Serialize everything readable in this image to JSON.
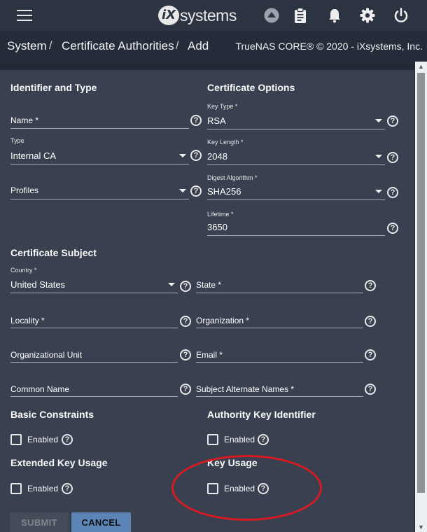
{
  "topbar": {
    "logo_mark": "iX",
    "logo_text": "systems",
    "icons": [
      "menu-icon",
      "truecommand-icon",
      "clipboard-icon",
      "bell-icon",
      "gear-icon",
      "power-icon"
    ]
  },
  "breadcrumb": {
    "items": [
      "System",
      "Certificate Authorities",
      "Add"
    ],
    "separator": "/",
    "copyright": "TrueNAS CORE® © 2020 - iXsystems, Inc."
  },
  "sections": {
    "identifier": "Identifier and Type",
    "options": "Certificate Options",
    "subject": "Certificate Subject",
    "basic_constraints": "Basic Constraints",
    "authority_key": "Authority Key Identifier",
    "extended_key": "Extended Key Usage",
    "key_usage": "Key Usage"
  },
  "fields": {
    "name": {
      "label": "Name *",
      "value": ""
    },
    "type": {
      "label": "Type",
      "value": "Internal CA"
    },
    "profiles": {
      "label": "Profiles",
      "value": ""
    },
    "key_type": {
      "label": "Key Type *",
      "value": "RSA"
    },
    "key_length": {
      "label": "Key Length *",
      "value": "2048"
    },
    "digest": {
      "label": "Digest Algorithm *",
      "value": "SHA256"
    },
    "lifetime": {
      "label": "Lifetime *",
      "value": "3650"
    },
    "country": {
      "label": "Country *",
      "value": "United States"
    },
    "state": {
      "label": "State *",
      "value": ""
    },
    "locality": {
      "label": "Locality *",
      "value": ""
    },
    "organization": {
      "label": "Organization *",
      "value": ""
    },
    "org_unit": {
      "label": "Organizational Unit",
      "value": ""
    },
    "email": {
      "label": "Email *",
      "value": ""
    },
    "common_name": {
      "label": "Common Name",
      "value": ""
    },
    "san": {
      "label": "Subject Alternate Names *",
      "value": ""
    }
  },
  "checkboxes": {
    "enabled_label": "Enabled",
    "basic_constraints": false,
    "authority_key": false,
    "extended_key": false,
    "key_usage": false
  },
  "help_glyph": "?",
  "buttons": {
    "submit": "SUBMIT",
    "cancel": "CANCEL"
  },
  "colors": {
    "annotation": "#d81b22",
    "cancel_button": "#5c84b6",
    "background": "#394150"
  }
}
